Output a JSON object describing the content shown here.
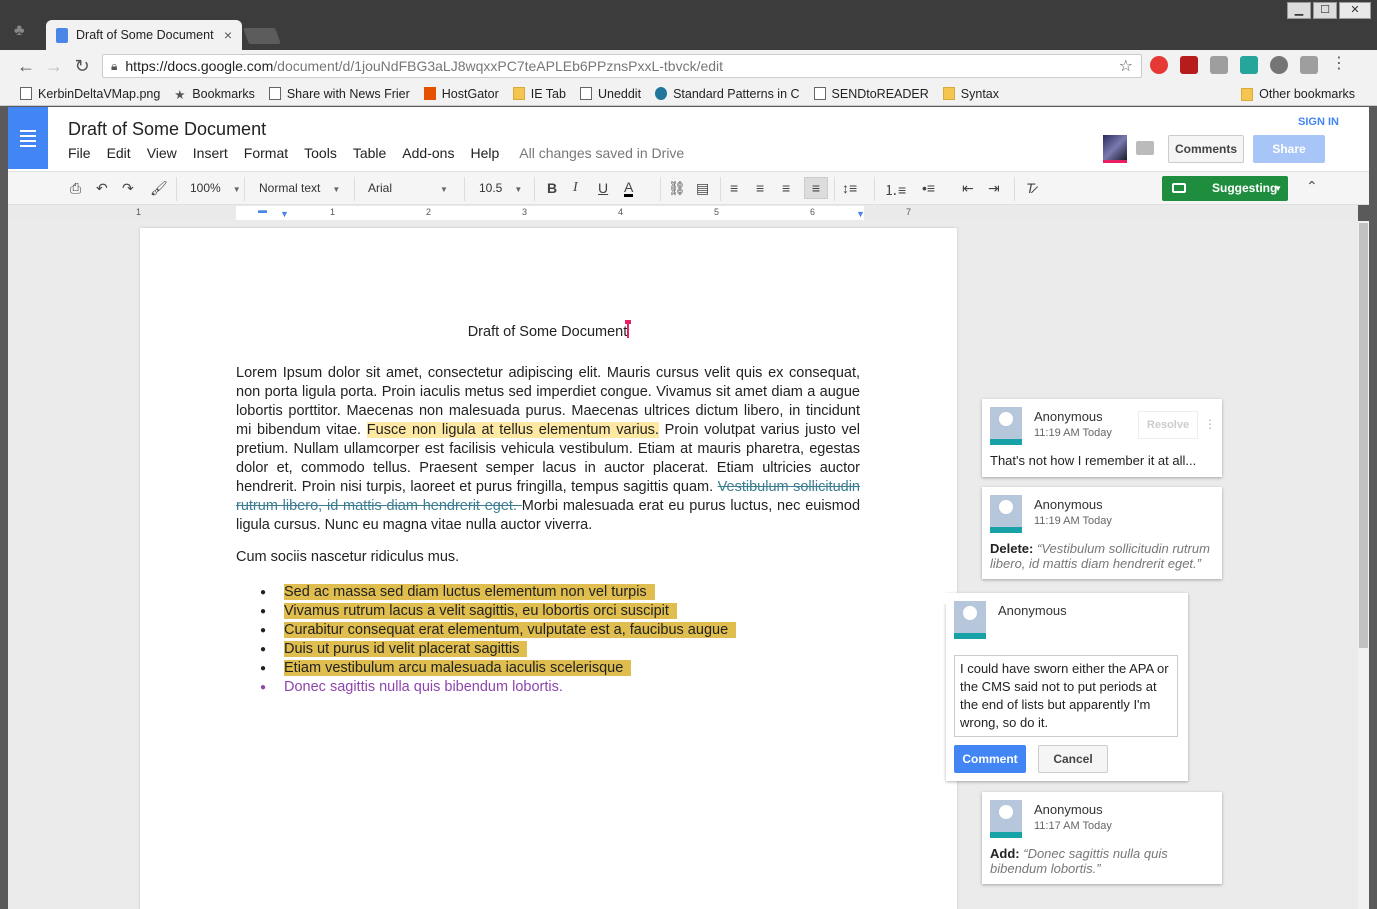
{
  "browser": {
    "tab_title": "Draft of Some Document",
    "tab_close": "×",
    "url_host": "https://docs.google.com",
    "url_rest": "/document/d/1jouNdFBG3aLJ8wqxxPC7teAPLEb6PPznsPxxL-tbvck/edit",
    "window_minimize": "▁",
    "window_maximize": "☐",
    "window_close": "✕"
  },
  "bookmarks": {
    "items": [
      "KerbinDeltaVMap.png",
      "Bookmarks",
      "Share with News Frier",
      "HostGator",
      "IE Tab",
      "Uneddit",
      "Standard Patterns in C",
      "SENDtoREADER",
      "Syntax"
    ],
    "other": "Other bookmarks"
  },
  "docs": {
    "title": "Draft of Some Document",
    "menu": [
      "File",
      "Edit",
      "View",
      "Insert",
      "Format",
      "Tools",
      "Table",
      "Add-ons",
      "Help"
    ],
    "saved_status": "All changes saved in Drive",
    "comments_button": "Comments",
    "share_button": "Share",
    "sign_in": "SIGN IN"
  },
  "format_bar": {
    "zoom": "100%",
    "style": "Normal text",
    "font": "Arial",
    "size": "10.5",
    "mode": "Suggesting"
  },
  "ruler": [
    "1",
    "1",
    "2",
    "3",
    "4",
    "5",
    "6",
    "7"
  ],
  "document": {
    "heading": "Draft of Some Document",
    "para1_a": "Lorem Ipsum dolor sit amet, consectetur adipiscing elit. Mauris cursus velit quis ex consequat, non porta ligula porta. Proin iaculis metus sed imperdiet congue. Vivamus sit amet diam a augue lobortis porttitor. Maecenas non malesuada purus. Maecenas ultrices dictum libero, in tincidunt mi bibendum vitae. ",
    "para1_hl": "Fusce non ligula at tellus elementum varius.",
    "para1_b": " Proin volutpat varius justo vel pretium. Nullam ullamcorper est facilisis vehicula vestibulum. Etiam at mauris pharetra, egestas dolor et, commodo tellus. Praesent semper lacus in auctor placerat. Etiam ultricies auctor hendrerit. Proin nisi turpis, laoreet et purus fringilla, tempus sagittis quam. ",
    "para1_strike": "Vestibulum sollicitudin rutrum libero, id mattis diam hendrerit eget. ",
    "para1_c": "Morbi malesuada erat eu purus luctus, nec euismod ligula cursus. Nunc eu magna vitae nulla auctor viverra.",
    "para2": "Cum sociis nascetur ridiculus mus.",
    "bullets": [
      "Sed ac massa sed diam luctus elementum non vel turpis",
      "Vivamus rutrum lacus a velit sagittis, eu lobortis orci suscipit",
      "Curabitur consequat erat elementum, vulputate est a, faucibus augue",
      "Duis ut purus id velit placerat sagittis",
      "Etiam vestibulum arcu malesuada iaculis scelerisque"
    ],
    "added_bullet": "Donec sagittis nulla quis bibendum lobortis."
  },
  "comments": [
    {
      "author": "Anonymous",
      "time": "11:19 AM Today",
      "text": "That's not how I remember it at all...",
      "resolve": "Resolve"
    },
    {
      "author": "Anonymous",
      "time": "11:19 AM Today",
      "label": "Delete:",
      "quote": "“Vestibulum sollicitudin rutrum libero, id mattis diam hendrerit eget.”"
    },
    {
      "author": "Anonymous",
      "draft": "I could have sworn either the APA or the CMS said not to put periods at the end of lists but apparently I'm wrong, so do it.",
      "submit": "Comment",
      "cancel": "Cancel"
    },
    {
      "author": "Anonymous",
      "time": "11:17 AM Today",
      "label": "Add:",
      "quote": "“Donec sagittis nulla quis bibendum lobortis.”"
    }
  ],
  "colors": {
    "docs_blue": "#4285f4",
    "suggest_green": "#1e8e3e",
    "highlight_yellow": "#fde9a4",
    "highlight_gold": "#dfbe4f",
    "suggestion_purple": "#8e44ad",
    "strike_teal": "#3c7d92"
  }
}
